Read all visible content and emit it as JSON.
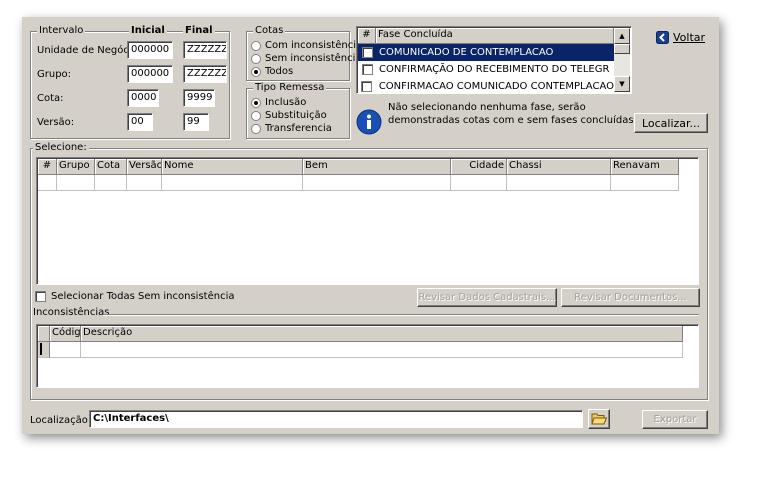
{
  "intervalo": {
    "title": "Intervalo",
    "col_inicial": "Inicial",
    "col_final": "Final",
    "rows": [
      {
        "label": "Unidade de Negócio:",
        "inicial": "000000",
        "final": "ZZZZZZ"
      },
      {
        "label": "Grupo:",
        "inicial": "000000",
        "final": "ZZZZZZ"
      },
      {
        "label": "Cota:",
        "inicial": "0000",
        "final": "9999"
      },
      {
        "label": "Versão:",
        "inicial": "00",
        "final": "99"
      }
    ]
  },
  "cotas": {
    "title": "Cotas",
    "options": [
      "Com inconsistência",
      "Sem inconsistência",
      "Todos"
    ],
    "selected": 2
  },
  "tipo_remessa": {
    "title": "Tipo Remessa",
    "options": [
      "Inclusão",
      "Substituição",
      "Transferencia"
    ],
    "selected": 0
  },
  "fases": {
    "col_hash": "#",
    "col_fase": "Fase Concluída",
    "rows": [
      "COMUNICADO DE CONTEMPLACAO",
      "CONFIRMAÇÃO DO RECEBIMENTO DO TELEGR",
      "CONFIRMACAO COMUNICADO CONTEMPLACAO"
    ],
    "selected_row": 0
  },
  "info_text": "Não selecionando nenhuma fase, serão demonstradas cotas com e sem fases concluídas.",
  "voltar_label": "Voltar",
  "localizar_label": "Localizar...",
  "selecione": {
    "title": "Selecione:",
    "columns": [
      "#",
      "Grupo",
      "Cota",
      "Versão",
      "Nome",
      "Bem",
      "Cidade",
      "Chassi",
      "Renavam"
    ]
  },
  "select_all_label": "Selecionar Todas Sem inconsistência",
  "revisar_dados_label": "Revisar Dados Cadastrais...",
  "revisar_docs_label": "Revisar Documentos...",
  "inconsistencias": {
    "title": "Inconsistências",
    "columns": [
      "Código",
      "Descrição"
    ]
  },
  "localizacao": {
    "label": "Localização:",
    "value": "C:\\Interfaces\\"
  },
  "exportar_label": "Exportar",
  "colors": {
    "window": "#d4d0c8",
    "selection": "#0a246a",
    "info_blue": "#1a4fb5"
  }
}
